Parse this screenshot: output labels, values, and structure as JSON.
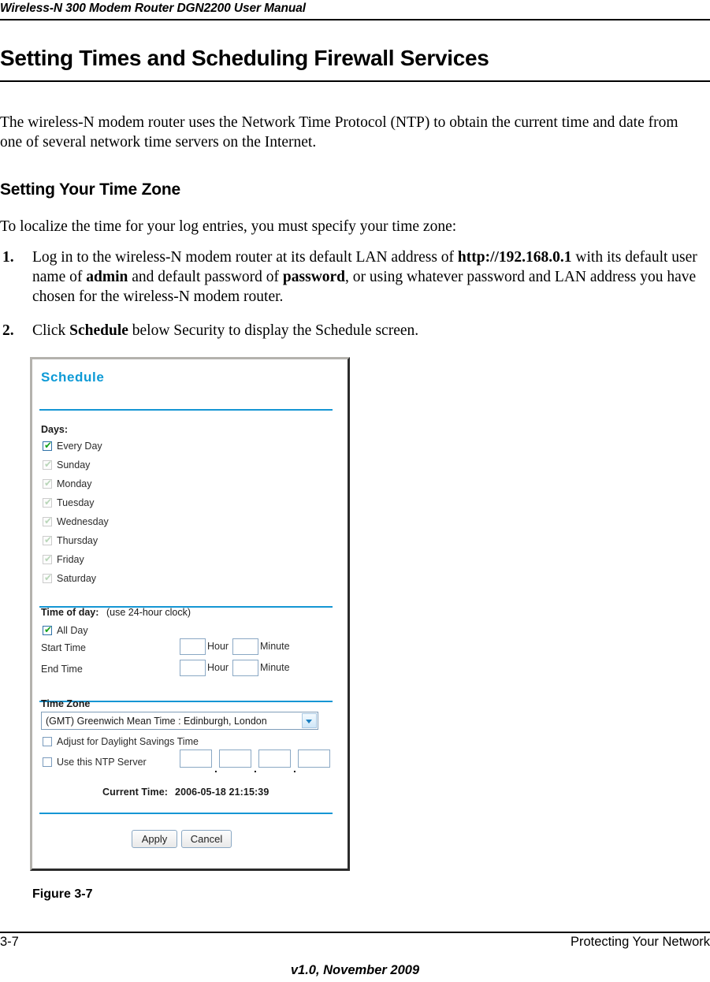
{
  "header": {
    "running_title": "Wireless-N 300 Modem Router DGN2200 User Manual"
  },
  "chapter": {
    "title": "Setting Times and Scheduling Firewall Services"
  },
  "content": {
    "intro_paragraph": "The wireless-N modem router uses the Network Time Protocol (NTP) to obtain the current time and date from one of several network time servers on the Internet.",
    "section_heading": "Setting Your Time Zone",
    "lead_in": "To localize the time for your log entries, you must specify your time zone:",
    "steps": [
      {
        "number": "1.",
        "part1": "Log in to the wireless-N modem router at its default LAN address of ",
        "bold1": "http://192.168.0.1",
        "part2": " with its default user name of ",
        "bold2": "admin",
        "part3": " and default password of ",
        "bold3": "password",
        "part4": ", or using whatever password and LAN address you have chosen for the wireless-N modem router."
      },
      {
        "number": "2.",
        "part1": "Click ",
        "bold1": "Schedule",
        "part2": " below Security to display the Schedule screen."
      }
    ]
  },
  "figure": {
    "caption": "Figure 3-7",
    "screen": {
      "title": "Schedule",
      "days_label": "Days:",
      "days": [
        {
          "label": "Every Day",
          "checked": true,
          "enabled": true
        },
        {
          "label": "Sunday",
          "checked": true,
          "enabled": false
        },
        {
          "label": "Monday",
          "checked": true,
          "enabled": false
        },
        {
          "label": "Tuesday",
          "checked": true,
          "enabled": false
        },
        {
          "label": "Wednesday",
          "checked": true,
          "enabled": false
        },
        {
          "label": "Thursday",
          "checked": true,
          "enabled": false
        },
        {
          "label": "Friday",
          "checked": true,
          "enabled": false
        },
        {
          "label": "Saturday",
          "checked": true,
          "enabled": false
        }
      ],
      "time_of_day_label": "Time of day:",
      "time_of_day_note": "(use 24-hour clock)",
      "all_day": {
        "label": "All Day",
        "checked": true
      },
      "start_time": {
        "label": "Start Time",
        "hour_value": "",
        "hour_unit": "Hour",
        "minute_value": "",
        "minute_unit": "Minute"
      },
      "end_time": {
        "label": "End Time",
        "hour_value": "",
        "hour_unit": "Hour",
        "minute_value": "",
        "minute_unit": "Minute"
      },
      "time_zone_label": "Time Zone",
      "time_zone_selected": "(GMT) Greenwich Mean Time : Edinburgh, London",
      "daylight_savings": {
        "label": "Adjust for Daylight Savings Time",
        "checked": false
      },
      "ntp_server": {
        "label": "Use this NTP Server",
        "checked": false,
        "octets": [
          "",
          "",
          "",
          ""
        ],
        "separator": "."
      },
      "current_time_label": "Current Time:",
      "current_time_value": "2006-05-18 21:15:39",
      "apply_button": "Apply",
      "cancel_button": "Cancel"
    },
    "colors": {
      "accent_blue": "#0d9ad6",
      "rule_blue": "#1596d4",
      "check_green": "#16a01a"
    }
  },
  "footer": {
    "page_number": "3-7",
    "section": "Protecting Your Network",
    "version": "v1.0, November 2009"
  }
}
